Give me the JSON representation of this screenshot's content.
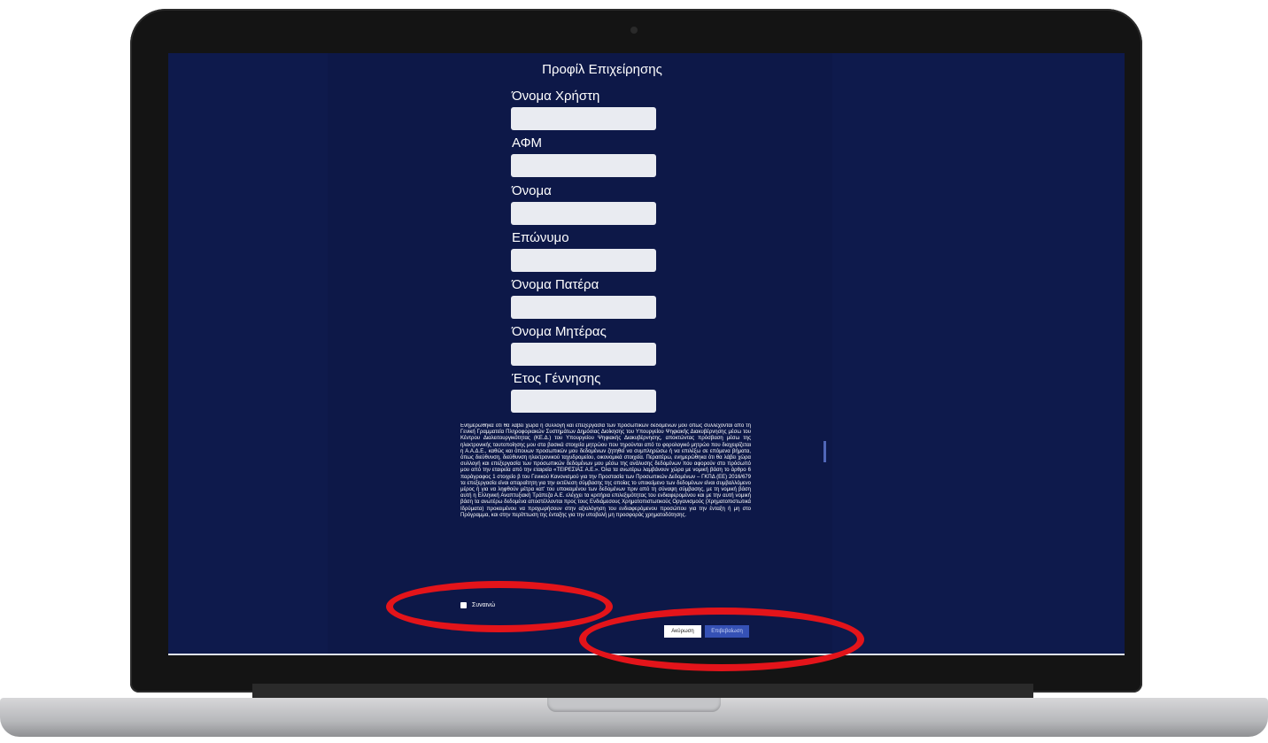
{
  "page": {
    "title": "Προφίλ Επιχείρησης"
  },
  "fields": [
    {
      "label": "Όνομα Χρήστη",
      "value": "",
      "placeholder": ""
    },
    {
      "label": "ΑΦΜ",
      "value": "",
      "placeholder": ""
    },
    {
      "label": "Όνομα",
      "value": "",
      "placeholder": ""
    },
    {
      "label": "Επώνυμο",
      "value": "",
      "placeholder": ""
    },
    {
      "label": "Όνομα Πατέρα",
      "value": "",
      "placeholder": ""
    },
    {
      "label": "Όνομα Μητέρας",
      "value": "",
      "placeholder": ""
    },
    {
      "label": "Έτος Γέννησης",
      "value": "",
      "placeholder": ""
    }
  ],
  "consent": {
    "text": "Ενημερώθηκα ότι θα λάβει χώρα η συλλογή και επεξεργασία των προσωπικών δεδομένων μου όπως συλλέχονται από τη Γενική Γραμματεία Πληροφοριακών Συστημάτων Δημόσιας Διοίκησης του Υπουργείου Ψηφιακής Διακυβέρνησης μέσω του Κέντρου Διαλειτουργικότητας (ΚΕ.Δ.) του Υπουργείου Ψηφιακής Διακυβέρνησης, αποκτώντας πρόσβαση μέσω της ηλεκτρονικής ταυτοποίησης μου στα βασικά στοιχεία μητρώου που τηρούνται από το φορολογικό μητρώο που διαχειρίζεται η Α.Α.Δ.Ε., καθώς και όπουων προσωπικών μου δεδομένων ζητηθεί να συμπληρώσω ή να επιλέξω σε επόμενα βήματα, όπως διεύθυνση, διεύθυνση ηλεκτρονικού ταχυδρομείου, οικονομικά στοιχεία. Περαιτέρω, ενημερώθηκα ότι θα λάβει χώρα συλλογή και επεξεργασία των προσωπικών δεδομένων μου μέσω της ανάλυσης δεδομένων που αφορούν στο πρόσωπό μου από την εταιρεία από την εταιρεία «ΤΕΙΡΕΣΙΑΣ Α.Ε.». Όλα τα ανωτέρω λαμβάνουν χώρα με νομική βάση το άρθρο 6 παράγραφος 1 στοιχείο β του Γενικού Κανονισμού για την Προστασία των Προσωπικών Δεδομένων – ΓΚΠΔ (ΕΕ) 2016/679 τα επεξεργασία είναι απαραίτητη για την εκτέλεση σύμβασης της οποίας το υποκείμενο των δεδομένων είναι συμβαλλόμενο μέρος ή για να ληφθούν μέτρα κατ' του υποκειμένου των δεδομένων πριν από τη σύναψη σύμβασης, με τη νομική βάση αυτή η Ελληνική Αναπτυξιακή Τράπεζα Α.Ε. ελέγχει τα κριτήρια επιλεξιμότητας του ενδιαφερομένου και με την αυτή νομική βάση τα ανωτέρω δεδομένα αποστέλλονται προς τους Ενδιάμεσους Χρηματοπιστωτικούς Οργανισμούς (Χρηματοπιστωτικά Ιδρύματα) προκειμένου να προχωρήσουν στην αξιολόγηση του ενδιαφερόμενου προσώπου για την ένταξη ή μη στο Πρόγραμμα, και στην περίπτωση της ένταξης για την υποβολή μη προσφοράς χρηματοδότησης."
  },
  "agree": {
    "label": "Συναινώ",
    "checked": false
  },
  "buttons": {
    "cancel": "Ακύρωση",
    "submit": "Επιβεβαίωση"
  },
  "colors": {
    "screen_bg": "#0d1848",
    "input_bg": "#e9ebf1",
    "submit_bg": "#3551b5",
    "annotation": "#e3141a"
  }
}
